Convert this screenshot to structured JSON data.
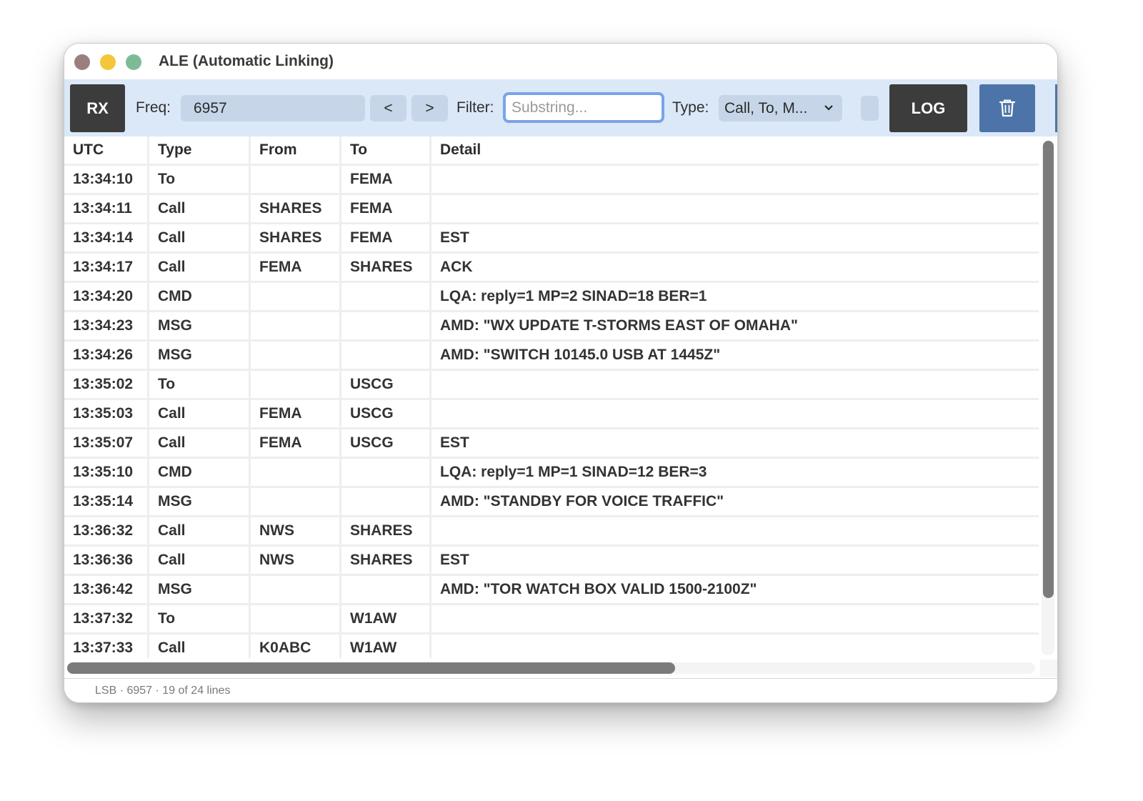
{
  "window": {
    "title": "ALE (Automatic Linking)"
  },
  "toolbar": {
    "rx_label": "RX",
    "freq_label": "Freq:",
    "freq_value": "6957",
    "prev_label": "<",
    "next_label": ">",
    "filter_label": "Filter:",
    "filter_placeholder": "Substring...",
    "filter_value": "",
    "type_label": "Type:",
    "type_value": "Call, To, M...",
    "log_label": "LOG",
    "trash_icon": "trash-icon"
  },
  "table": {
    "headers": [
      "UTC",
      "Type",
      "From",
      "To",
      "Detail"
    ],
    "rows": [
      [
        "13:34:10",
        "To",
        "",
        "FEMA",
        ""
      ],
      [
        "13:34:11",
        "Call",
        "SHARES",
        "FEMA",
        ""
      ],
      [
        "13:34:14",
        "Call",
        "SHARES",
        "FEMA",
        "EST"
      ],
      [
        "13:34:17",
        "Call",
        "FEMA",
        "SHARES",
        "ACK"
      ],
      [
        "13:34:20",
        "CMD",
        "",
        "",
        "LQA: reply=1 MP=2 SINAD=18 BER=1"
      ],
      [
        "13:34:23",
        "MSG",
        "",
        "",
        "AMD: \"WX UPDATE T-STORMS EAST OF OMAHA\""
      ],
      [
        "13:34:26",
        "MSG",
        "",
        "",
        "AMD: \"SWITCH 10145.0 USB AT 1445Z\""
      ],
      [
        "13:35:02",
        "To",
        "",
        "USCG",
        ""
      ],
      [
        "13:35:03",
        "Call",
        "FEMA",
        "USCG",
        ""
      ],
      [
        "13:35:07",
        "Call",
        "FEMA",
        "USCG",
        "EST"
      ],
      [
        "13:35:10",
        "CMD",
        "",
        "",
        "LQA: reply=1 MP=1 SINAD=12 BER=3"
      ],
      [
        "13:35:14",
        "MSG",
        "",
        "",
        "AMD: \"STANDBY FOR VOICE TRAFFIC\""
      ],
      [
        "13:36:32",
        "Call",
        "NWS",
        "SHARES",
        ""
      ],
      [
        "13:36:36",
        "Call",
        "NWS",
        "SHARES",
        "EST"
      ],
      [
        "13:36:42",
        "MSG",
        "",
        "",
        "AMD: \"TOR WATCH BOX VALID 1500-2100Z\""
      ],
      [
        "13:37:32",
        "To",
        "",
        "W1AW",
        ""
      ],
      [
        "13:37:33",
        "Call",
        "K0ABC",
        "W1AW",
        ""
      ]
    ]
  },
  "status": {
    "text": "LSB · 6957 · 19 of 24 lines"
  },
  "colors": {
    "toolbar_bg": "#dbe8f7",
    "dark_button": "#3c3c3c",
    "trash_button": "#4d74a8",
    "focus_ring": "#7aa3e8"
  }
}
